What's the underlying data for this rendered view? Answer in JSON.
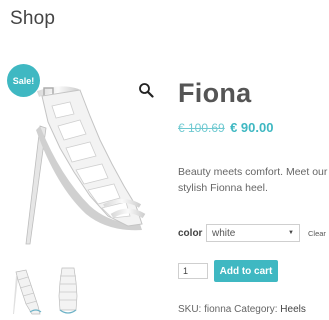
{
  "page": {
    "heading": "Shop"
  },
  "gallery": {
    "badge": "Sale!",
    "zoom_icon": "magnifier-icon",
    "thumbnails": [
      "sandal-white-side",
      "sandal-white-front"
    ]
  },
  "product": {
    "title": "Fiona",
    "price_old": "€ 100.69",
    "price_new": "€ 90.00",
    "description": "Beauty meets comfort. Meet our stylish Fionna heel."
  },
  "variations": {
    "label": "color",
    "selected": "white",
    "reset": "Clear"
  },
  "cart": {
    "quantity": "1",
    "button": "Add to cart"
  },
  "meta": {
    "sku_label": "SKU:",
    "sku_value": "fionna",
    "category_label": "Category:",
    "category_value": "Heels"
  },
  "colors": {
    "accent": "#3fb8c2",
    "text": "#666666",
    "heading": "#555555"
  }
}
